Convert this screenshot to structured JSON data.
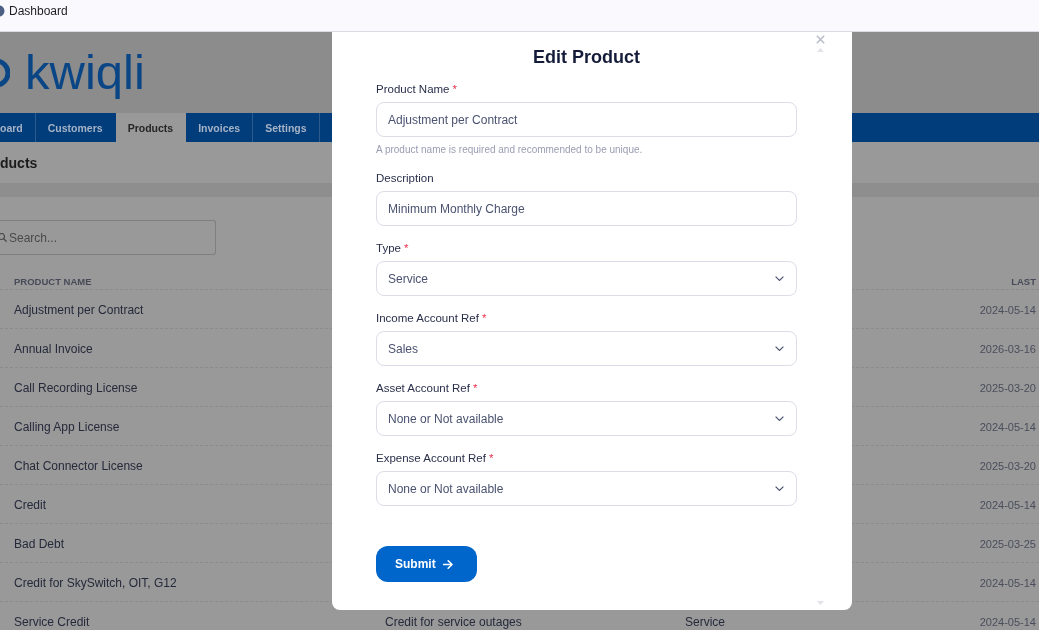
{
  "browser_tab": {
    "title": "Dashboard"
  },
  "logo": {
    "text": "kwiqli"
  },
  "nav": {
    "tabs": [
      {
        "label": "oard",
        "selected": false
      },
      {
        "label": "Customers",
        "selected": false
      },
      {
        "label": "Products",
        "selected": true
      },
      {
        "label": "Invoices",
        "selected": false
      },
      {
        "label": "Settings",
        "selected": false
      }
    ]
  },
  "page_title": "ducts",
  "search": {
    "placeholder": "Search..."
  },
  "table": {
    "header": {
      "product_name": "PRODUCT NAME",
      "column_4": "LAST"
    },
    "rows": [
      {
        "product_name": "Adjustment per Contract",
        "column_4": "2024-05-14"
      },
      {
        "product_name": "Annual Invoice",
        "column_4": "2026-03-16"
      },
      {
        "product_name": "Call Recording License",
        "column_4": "2025-03-20"
      },
      {
        "product_name": "Calling App License",
        "column_4": "2024-05-14"
      },
      {
        "product_name": "Chat Connector License",
        "column_4": "2025-03-20"
      },
      {
        "product_name": "Credit",
        "column_4": "2024-05-14"
      },
      {
        "product_name": "Bad Debt",
        "column_4": "2025-03-25"
      },
      {
        "product_name": "Credit for SkySwitch, OIT, G12",
        "column_4": "2024-05-14"
      },
      {
        "product_name": "Service Credit",
        "column_2": "Credit for service outages",
        "column_3": "Service",
        "column_4": "2024-05-14"
      }
    ]
  },
  "modal": {
    "title": "Edit Product",
    "fields": [
      {
        "kind": "text",
        "label": "Product Name",
        "required_mark": "*",
        "value": "Adjustment per Contract",
        "help_text": "A product name is required and recommended to be unique."
      },
      {
        "kind": "text",
        "label": "Description",
        "value": "Minimum Monthly Charge"
      },
      {
        "kind": "select",
        "label": "Type",
        "required_mark": "*",
        "value": "Service"
      },
      {
        "kind": "select",
        "label": "Income Account Ref",
        "required_mark": "*",
        "value": "Sales"
      },
      {
        "kind": "select",
        "label": "Asset Account Ref",
        "required_mark": "*",
        "value": "None or Not available"
      },
      {
        "kind": "select",
        "label": "Expense Account Ref",
        "required_mark": "*",
        "value": "None or Not available"
      }
    ],
    "submit": {
      "label": "Submit"
    }
  }
}
